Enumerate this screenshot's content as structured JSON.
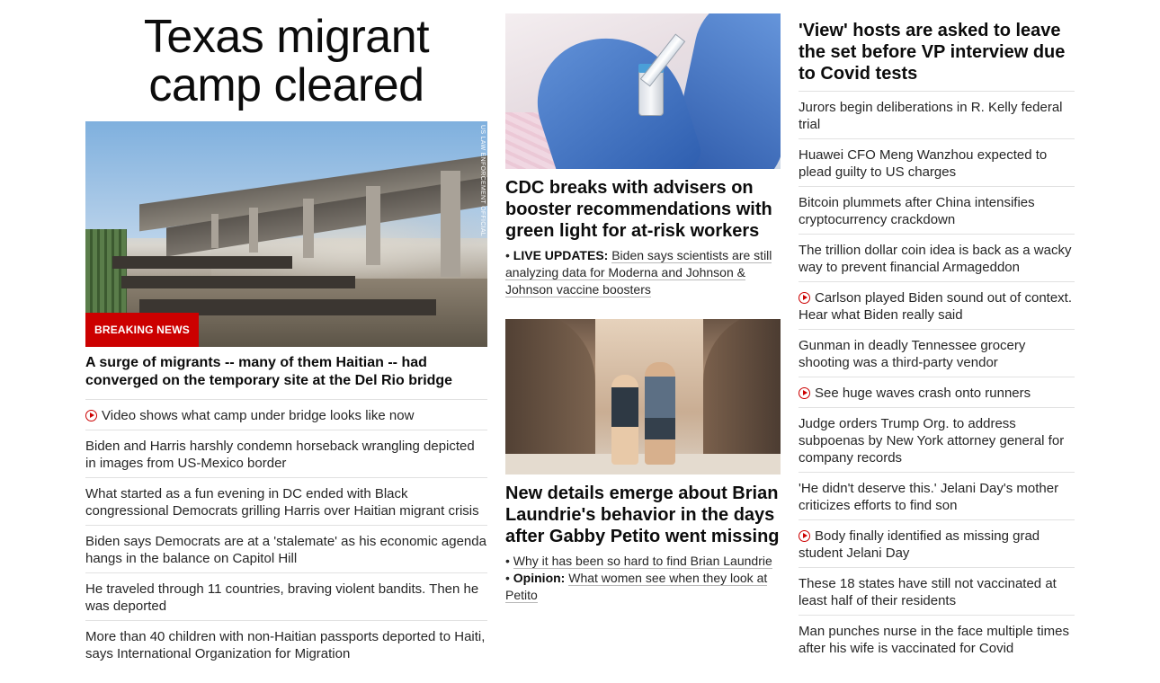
{
  "col1": {
    "banner": "Texas migrant camp cleared",
    "image_credit": "US LAW ENFORCEMENT OFFICIAL",
    "badge": "BREAKING NEWS",
    "headline": "A surge of migrants -- many of them Haitian -- had converged on the temporary site at the Del Rio bridge",
    "items": [
      {
        "text": "Video shows what camp under bridge looks like now",
        "video": true
      },
      {
        "text": "Biden and Harris harshly condemn horseback wrangling depicted in images from US-Mexico border",
        "video": false
      },
      {
        "text": "What started as a fun evening in DC ended with Black congressional Democrats grilling Harris over Haitian migrant crisis",
        "video": false
      },
      {
        "text": "Biden says Democrats are at a 'stalemate' as his economic agenda hangs in the balance on Capitol Hill",
        "video": false
      },
      {
        "text": "He traveled through 11 countries, braving violent bandits. Then he was deported",
        "video": false
      },
      {
        "text": "More than 40 children with non-Haitian passports deported to Haiti, says International Organization for Migration",
        "video": false
      }
    ]
  },
  "col2": {
    "story1": {
      "title": "CDC breaks with advisers on booster recommendations with green light for at-risk workers",
      "bullets": [
        {
          "label": "LIVE UPDATES:",
          "text": "Biden says scientists are still analyzing data for Moderna and Johnson & Johnson vaccine boosters"
        }
      ]
    },
    "story2": {
      "title": "New details emerge about Brian Laundrie's behavior in the days after Gabby Petito went missing",
      "bullets": [
        {
          "label": "",
          "text": "Why it has been so hard to find Brian Laundrie"
        },
        {
          "label": "Opinion:",
          "text": "What women see when they look at Petito"
        }
      ]
    }
  },
  "col3": {
    "lead": "'View' hosts are asked to leave the set before VP interview due to Covid tests",
    "items": [
      {
        "text": "Jurors begin deliberations in R. Kelly federal trial",
        "video": false
      },
      {
        "text": "Huawei CFO Meng Wanzhou expected to plead guilty to US charges",
        "video": false
      },
      {
        "text": "Bitcoin plummets after China intensifies cryptocurrency crackdown",
        "video": false
      },
      {
        "text": "The trillion dollar coin idea is back as a wacky way to prevent financial Armageddon",
        "video": false
      },
      {
        "text": "Carlson played Biden sound out of context. Hear what Biden really said",
        "video": true
      },
      {
        "text": "Gunman in deadly Tennessee grocery shooting was a third-party vendor",
        "video": false
      },
      {
        "text": "See huge waves crash onto runners",
        "video": true
      },
      {
        "text": "Judge orders Trump Org. to address subpoenas by New York attorney general for company records",
        "video": false
      },
      {
        "text": "'He didn't deserve this.' Jelani Day's mother criticizes efforts to find son",
        "video": false
      },
      {
        "text": "Body finally identified as missing grad student Jelani Day",
        "video": true
      },
      {
        "text": "These 18 states have still not vaccinated at least half of their residents",
        "video": false
      },
      {
        "text": "Man punches nurse in the face multiple times after his wife is vaccinated for Covid",
        "video": false
      }
    ]
  },
  "colors": {
    "accent": "#cc0000",
    "text": "#262626",
    "divider": "#e1e1e1"
  },
  "icons": {
    "video": "play-circle-icon"
  }
}
